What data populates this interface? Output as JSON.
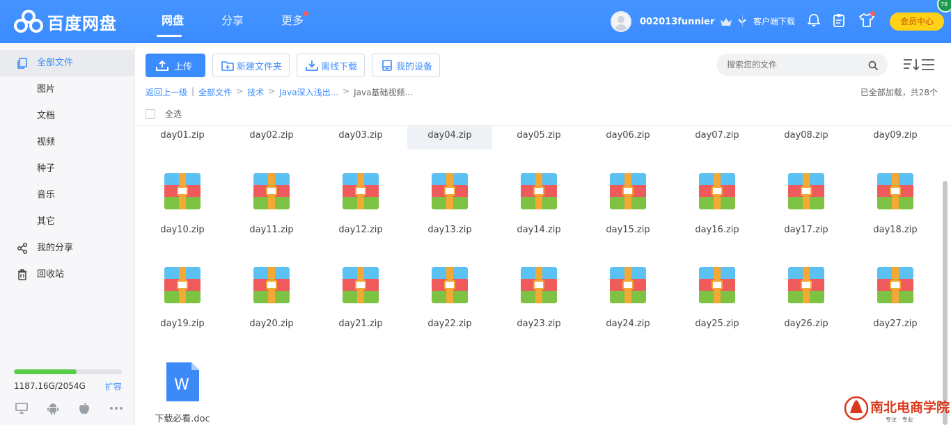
{
  "header": {
    "brand": "百度网盘",
    "nav": [
      {
        "label": "网盘",
        "active": true
      },
      {
        "label": "分享",
        "active": false
      },
      {
        "label": "更多",
        "active": false,
        "badge": true
      }
    ],
    "username": "002013funnier",
    "client_download": "客户端下载",
    "vip_button": "会员中心",
    "corner_badge": "78"
  },
  "sidebar": {
    "items": [
      {
        "label": "全部文件",
        "icon": "file-stack-icon",
        "active": true
      },
      {
        "label": "图片"
      },
      {
        "label": "文档"
      },
      {
        "label": "视频"
      },
      {
        "label": "种子"
      },
      {
        "label": "音乐"
      },
      {
        "label": "其它"
      },
      {
        "label": "我的分享",
        "icon": "share-icon"
      },
      {
        "label": "回收站",
        "icon": "trash-icon"
      }
    ],
    "storage": {
      "used_fraction": 0.579,
      "text": "1187.16G/2054G",
      "expand": "扩容"
    },
    "devices": [
      "desktop-icon",
      "android-icon",
      "apple-icon",
      "more-icon"
    ]
  },
  "toolbar": {
    "upload": "上传",
    "new_folder": "新建文件夹",
    "offline_download": "离线下载",
    "my_devices": "我的设备",
    "search_placeholder": "搜索您的文件"
  },
  "breadcrumb": {
    "back": "返回上一级",
    "items": [
      "全部文件",
      "技术",
      "Java深入浅出...",
      "Java基础视频..."
    ]
  },
  "status": {
    "loaded": "已全部加载，共28个"
  },
  "select_all": "全选",
  "files": [
    "day01.zip",
    "day02.zip",
    "day03.zip",
    "day04.zip",
    "day05.zip",
    "day06.zip",
    "day07.zip",
    "day08.zip",
    "day09.zip",
    "day10.zip",
    "day11.zip",
    "day12.zip",
    "day13.zip",
    "day14.zip",
    "day15.zip",
    "day16.zip",
    "day17.zip",
    "day18.zip",
    "day19.zip",
    "day20.zip",
    "day21.zip",
    "day22.zip",
    "day23.zip",
    "day24.zip",
    "day25.zip",
    "day26.zip",
    "day27.zip",
    "下载必看.doc"
  ],
  "watermark": {
    "brand": "南北电商学院",
    "slogan": "专注 · 专业"
  }
}
